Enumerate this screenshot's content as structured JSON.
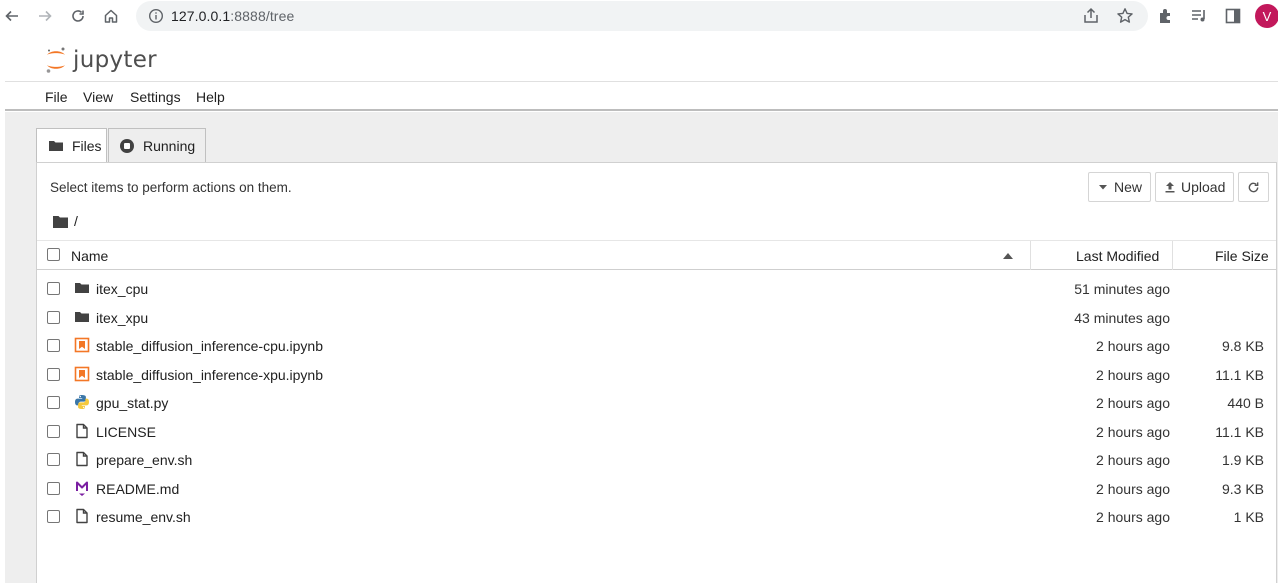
{
  "browser": {
    "url_host": "127.0.0.1",
    "url_rest": ":8888/tree",
    "avatar_letter": "V"
  },
  "header": {
    "logo_text": "jupyter"
  },
  "menu": [
    "File",
    "View",
    "Settings",
    "Help"
  ],
  "tabs": [
    {
      "label": "Files",
      "active": true
    },
    {
      "label": "Running",
      "active": false
    }
  ],
  "panel": {
    "note": "Select items to perform actions on them.",
    "new_label": "New",
    "upload_label": "Upload",
    "breadcrumb": "/"
  },
  "columns": {
    "name": "Name",
    "modified": "Last Modified",
    "size": "File Size"
  },
  "files": [
    {
      "name": "itex_cpu",
      "type": "folder",
      "modified": "51 minutes ago",
      "size": ""
    },
    {
      "name": "itex_xpu",
      "type": "folder",
      "modified": "43 minutes ago",
      "size": ""
    },
    {
      "name": "stable_diffusion_inference-cpu.ipynb",
      "type": "notebook",
      "modified": "2 hours ago",
      "size": "9.8 KB"
    },
    {
      "name": "stable_diffusion_inference-xpu.ipynb",
      "type": "notebook",
      "modified": "2 hours ago",
      "size": "11.1 KB"
    },
    {
      "name": "gpu_stat.py",
      "type": "python",
      "modified": "2 hours ago",
      "size": "440 B"
    },
    {
      "name": "LICENSE",
      "type": "file",
      "modified": "2 hours ago",
      "size": "11.1 KB"
    },
    {
      "name": "prepare_env.sh",
      "type": "file",
      "modified": "2 hours ago",
      "size": "1.9 KB"
    },
    {
      "name": "README.md",
      "type": "markdown",
      "modified": "2 hours ago",
      "size": "9.3 KB"
    },
    {
      "name": "resume_env.sh",
      "type": "file",
      "modified": "2 hours ago",
      "size": "1 KB"
    }
  ]
}
